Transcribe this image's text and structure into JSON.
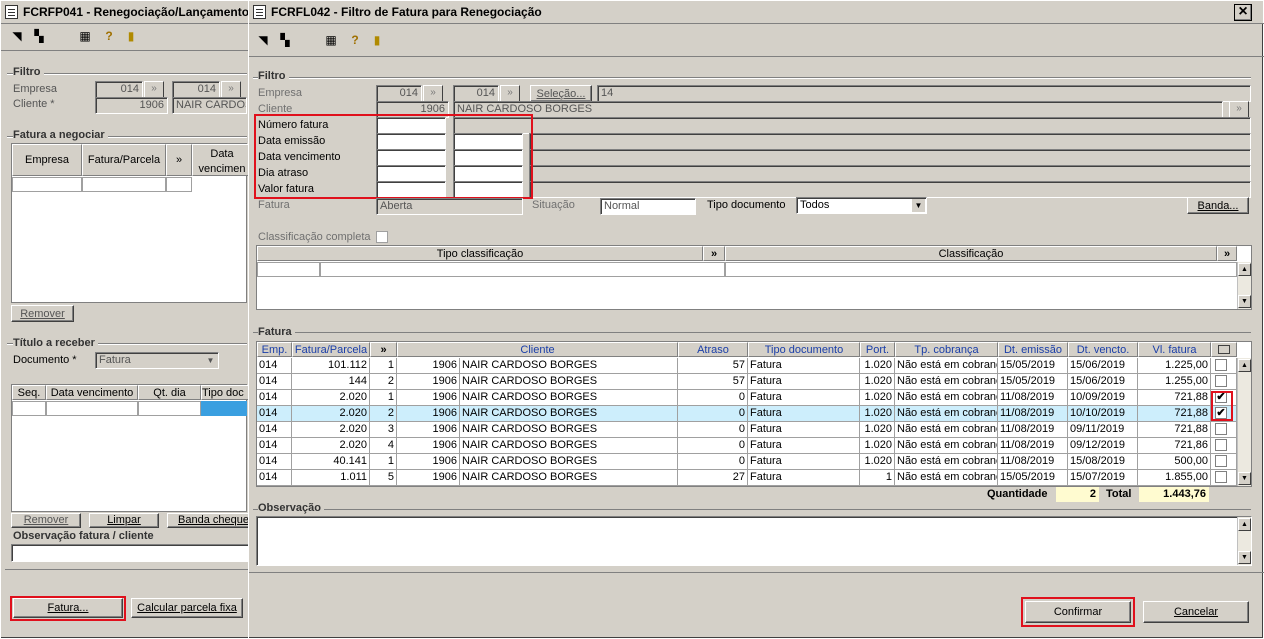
{
  "back_window": {
    "title": "FCRFP041 - Renegociação/Lançamento",
    "filtro_label": "Filtro",
    "empresa_label": "Empresa",
    "empresa_value": "014",
    "empresa_value2": "014",
    "cliente_label": "Cliente *",
    "cliente_code": "1906",
    "cliente_name": "NAIR CARDOSO",
    "fatura_negociar_label": "Fatura a negociar",
    "fn_headers": [
      "Empresa",
      "Fatura/Parcela",
      "»",
      "Data vencimen"
    ],
    "remover_label": "Remover",
    "titulo_receber_label": "Título a receber",
    "documento_label": "Documento *",
    "documento_value": "Fatura",
    "tr_headers": [
      "Seq.",
      "Data vencimento",
      "Qt. dia",
      "Tipo doc"
    ],
    "remover2_label": "Remover",
    "limpar_label": "Limpar",
    "banda_cheque_label": "Banda cheque",
    "obs_label": "Observação fatura / cliente",
    "fatura_btn": "Fatura...",
    "calcular_btn": "Calcular parcela fixa"
  },
  "dialog": {
    "title": "FCRFL042 - Filtro de Fatura para Renegociação",
    "close_label": "×",
    "filtro_label": "Filtro",
    "empresa_label": "Empresa",
    "empresa_value": "014",
    "empresa_value2": "014",
    "selecao_label": "Seleção...",
    "selecao_value": "14",
    "cliente_label": "Cliente",
    "cliente_code": "1906",
    "cliente_name": "NAIR CARDOSO BORGES",
    "numero_fatura_label": "Número fatura",
    "data_emissao_label": "Data emissão",
    "data_vencimento_label": "Data vencimento",
    "dia_atraso_label": "Dia atraso",
    "valor_fatura_label": "Valor fatura",
    "fatura_label": "Fatura",
    "fatura_value": "Aberta",
    "situacao_label": "Situação",
    "situacao_value": "Normal",
    "tipo_documento_label": "Tipo documento",
    "tipo_documento_value": "Todos",
    "banda_label": "Banda...",
    "classificacao_completa_label": "Classificação completa",
    "tipo_classificacao_header": "Tipo classificação",
    "classificacao_header": "Classificação",
    "expand_label": "»",
    "fatura_grid_label": "Fatura",
    "grid_headers": [
      "Emp.",
      "Fatura/Parcela",
      "»",
      "Cliente",
      "Atraso",
      "Tipo documento",
      "Port.",
      "Tp. cobrança",
      "Dt. emissão",
      "Dt. vencto.",
      "Vl. fatura"
    ],
    "rows": [
      {
        "emp": "014",
        "fatura": "101.112",
        "parcela": "1",
        "cod": "1906",
        "cliente": "NAIR CARDOSO BORGES",
        "atraso": "57",
        "tipo": "Fatura",
        "port": "1.020",
        "cobranca": "Não está em cobrança",
        "emissao": "15/05/2019",
        "vencto": "15/06/2019",
        "valor": "1.225,00",
        "checked": ""
      },
      {
        "emp": "014",
        "fatura": "144",
        "parcela": "2",
        "cod": "1906",
        "cliente": "NAIR CARDOSO BORGES",
        "atraso": "57",
        "tipo": "Fatura",
        "port": "1.020",
        "cobranca": "Não está em cobrança",
        "emissao": "15/05/2019",
        "vencto": "15/06/2019",
        "valor": "1.255,00",
        "checked": ""
      },
      {
        "emp": "014",
        "fatura": "2.020",
        "parcela": "1",
        "cod": "1906",
        "cliente": "NAIR CARDOSO BORGES",
        "atraso": "0",
        "tipo": "Fatura",
        "port": "1.020",
        "cobranca": "Não está em cobrança",
        "emissao": "11/08/2019",
        "vencto": "10/09/2019",
        "valor": "721,88",
        "checked": "✔"
      },
      {
        "emp": "014",
        "fatura": "2.020",
        "parcela": "2",
        "cod": "1906",
        "cliente": "NAIR CARDOSO BORGES",
        "atraso": "0",
        "tipo": "Fatura",
        "port": "1.020",
        "cobranca": "Não está em cobrança",
        "emissao": "11/08/2019",
        "vencto": "10/10/2019",
        "valor": "721,88",
        "checked": "✔"
      },
      {
        "emp": "014",
        "fatura": "2.020",
        "parcela": "3",
        "cod": "1906",
        "cliente": "NAIR CARDOSO BORGES",
        "atraso": "0",
        "tipo": "Fatura",
        "port": "1.020",
        "cobranca": "Não está em cobrança",
        "emissao": "11/08/2019",
        "vencto": "09/11/2019",
        "valor": "721,88",
        "checked": ""
      },
      {
        "emp": "014",
        "fatura": "2.020",
        "parcela": "4",
        "cod": "1906",
        "cliente": "NAIR CARDOSO BORGES",
        "atraso": "0",
        "tipo": "Fatura",
        "port": "1.020",
        "cobranca": "Não está em cobrança",
        "emissao": "11/08/2019",
        "vencto": "09/12/2019",
        "valor": "721,86",
        "checked": ""
      },
      {
        "emp": "014",
        "fatura": "40.141",
        "parcela": "1",
        "cod": "1906",
        "cliente": "NAIR CARDOSO BORGES",
        "atraso": "0",
        "tipo": "Fatura",
        "port": "1.020",
        "cobranca": "Não está em cobrança",
        "emissao": "11/08/2019",
        "vencto": "15/08/2019",
        "valor": "500,00",
        "checked": ""
      },
      {
        "emp": "014",
        "fatura": "1.011",
        "parcela": "5",
        "cod": "1906",
        "cliente": "NAIR CARDOSO BORGES",
        "atraso": "27",
        "tipo": "Fatura",
        "port": "1",
        "cobranca": "Não está em cobrança",
        "emissao": "15/05/2019",
        "vencto": "15/07/2019",
        "valor": "1.855,00",
        "checked": ""
      }
    ],
    "quantidade_label": "Quantidade",
    "quantidade_value": "2",
    "total_label": "Total",
    "total_value": "1.443,76",
    "observacao_label": "Observação",
    "confirmar_label": "Confirmar",
    "cancelar_label": "Cancelar"
  },
  "colors": {
    "highlight_red": "#e0101c",
    "selected_row": "#cdeefc",
    "header_blue": "#1a3ea8"
  }
}
